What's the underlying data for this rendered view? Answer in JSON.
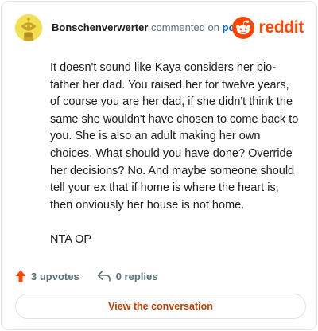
{
  "comment": {
    "author": "Bonschenverwerter",
    "action_text": "commented on",
    "post_link": "post",
    "paragraphs": [
      "It doesn't sound like Kaya considers her bio-father her dad. You raised her for twelve years, of course you are her dad, if she didn't think the same she wouldn't have chosen to come back to you. She is also an adult making her own choices. What should you have done? Override her decisions? No. And maybe someone should tell your ex that if home is where the heart is, then onviously her house is not home.",
      "NTA OP"
    ]
  },
  "brand": {
    "logo_text": "reddit",
    "color": "#ff4500"
  },
  "stats": {
    "upvotes": "3 upvotes",
    "replies": "0 replies"
  },
  "cta": {
    "label": "View the conversation"
  },
  "colors": {
    "upvote": "#ff4500",
    "cta_text": "#c43c00",
    "link": "#0b5fc6",
    "muted": "#576f76"
  }
}
